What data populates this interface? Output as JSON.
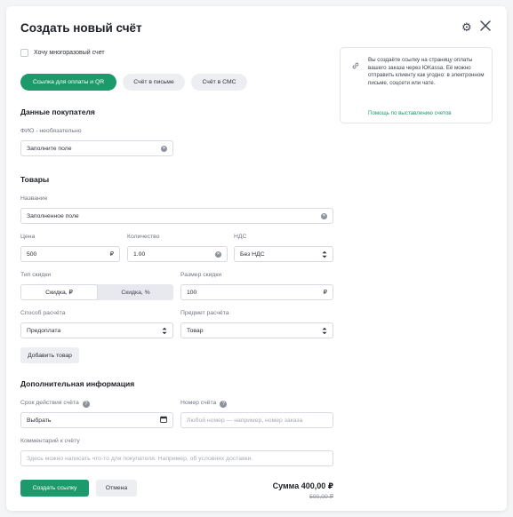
{
  "modal": {
    "title": "Создать новый счёт"
  },
  "reusable_checkbox": {
    "label": "Хочу многоразовый счет",
    "checked": false
  },
  "delivery_tabs": [
    {
      "label": "Ссылка для оплаты и QR",
      "active": true
    },
    {
      "label": "Счёт в письме",
      "active": false
    },
    {
      "label": "Счёт в СМС",
      "active": false
    }
  ],
  "info_box": {
    "text": "Вы создаёте ссылку на страницу оплаты вашего заказа через ЮKassa. Её можно отправить клиенту как угодно: в электронном письме, соцсети или чате.",
    "link": "Помощь по выставлению счетов"
  },
  "buyer": {
    "heading": "Данные покупателя",
    "name_label": "ФИО - необязательно",
    "name_value": "Заполните поле"
  },
  "goods": {
    "heading": "Товары",
    "name_label": "Название",
    "name_value": "Заполненное поле",
    "price_label": "Цена",
    "price_value": "500",
    "price_currency": "₽",
    "qty_label": "Количество",
    "qty_value": "1.00",
    "vat_label": "НДС",
    "vat_value": "Без НДС",
    "discount_type_label": "Тип скидки",
    "discount_options": [
      "Скидка, ₽",
      "Скидка, %"
    ],
    "discount_selected": "Скидка, ₽",
    "discount_size_label": "Размер скидки",
    "discount_size_value": "100",
    "discount_currency": "₽",
    "payment_method_label": "Способ расчёта",
    "payment_method_value": "Предоплата",
    "payment_subject_label": "Предмет расчёта",
    "payment_subject_value": "Товар",
    "add_button": "Добавить товар"
  },
  "additional": {
    "heading": "Дополнительная информация",
    "validity_label": "Срок действия счёта",
    "validity_value": "Выбрать",
    "invoice_number_label": "Номер счёта",
    "invoice_number_placeholder": "Любой номер — например, номер заказа",
    "comment_label": "Комментарий к счёту",
    "comment_placeholder": "Здесь можно написать что-то для покупателя. Например, об условиях доставки."
  },
  "footer": {
    "create_button": "Создать ссылку",
    "cancel_button": "Отмена",
    "sum_text": "Сумма 400,00 ₽",
    "old_sum_text": "500,00 ₽"
  },
  "colors": {
    "accent": "#1d9a6c",
    "background": "#f4f5f7",
    "surface": "#ffffff"
  }
}
